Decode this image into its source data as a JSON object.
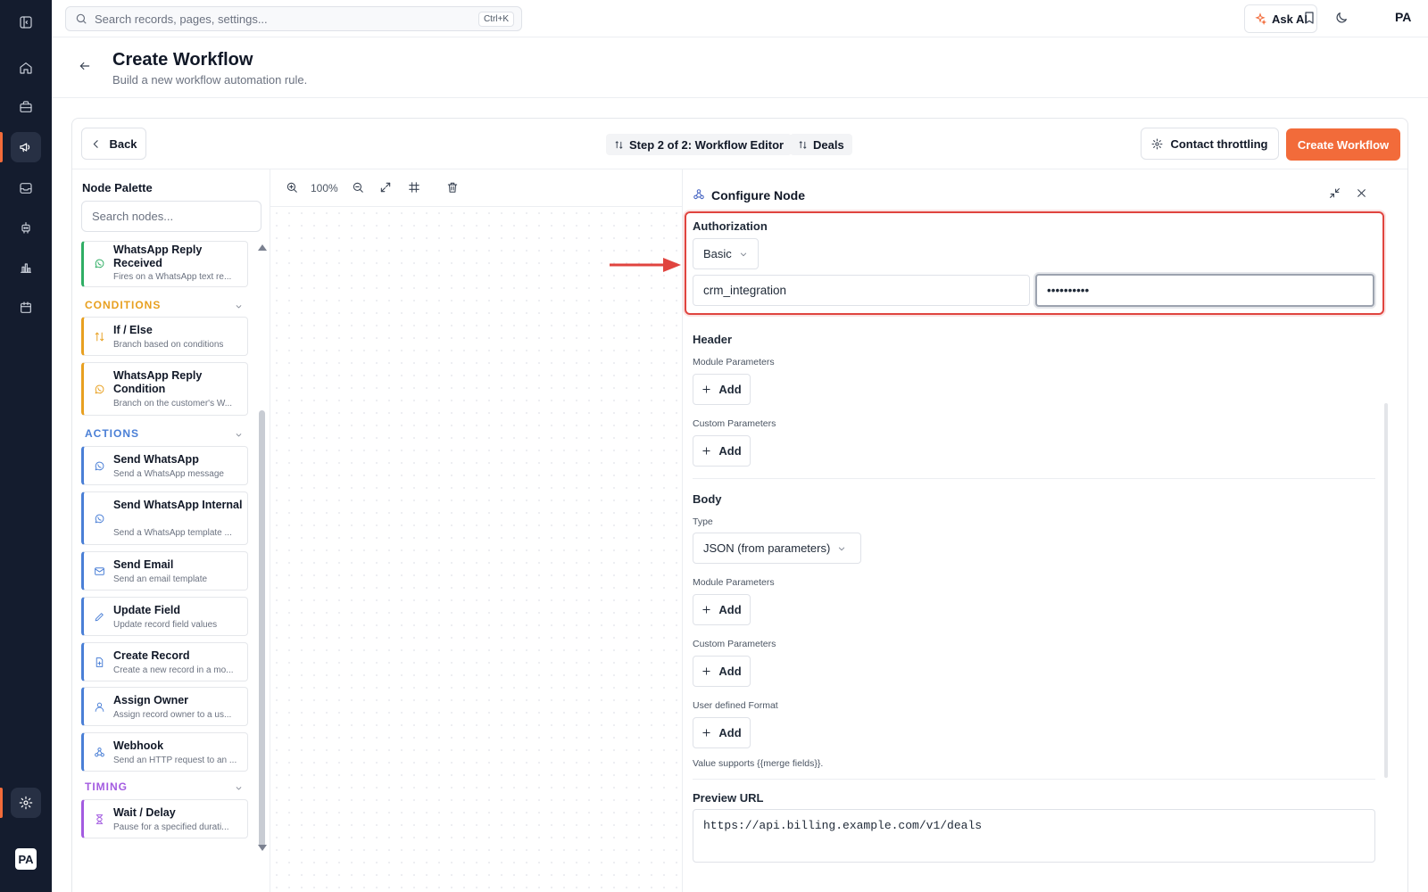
{
  "topbar": {
    "search_placeholder": "Search records, pages, settings...",
    "search_shortcut": "Ctrl+K",
    "ask_ai_label": "Ask AI",
    "avatar": "PA"
  },
  "sidebar": {
    "avatar": "PA",
    "items": [
      "panel-icon",
      "home-icon",
      "briefcase-icon",
      "megaphone-icon",
      "inbox-icon",
      "bot-icon",
      "bar-chart-icon",
      "calendar-icon",
      "gear-icon"
    ]
  },
  "header": {
    "title": "Create Workflow",
    "subtitle": "Build a new workflow automation rule."
  },
  "toolbar": {
    "back_label": "Back",
    "step_label": "Step 2 of 2: Workflow Editor",
    "module_label": "Deals",
    "throttling_label": "Contact throttling",
    "create_label": "Create Workflow"
  },
  "palette": {
    "title": "Node Palette",
    "search_placeholder": "Search nodes...",
    "triggers": [
      {
        "name": "WhatsApp Reply Received",
        "desc": "Fires on a WhatsApp text re..."
      }
    ],
    "categories": {
      "conditions": "CONDITIONS",
      "actions": "ACTIONS",
      "timing": "TIMING"
    },
    "conditions": [
      {
        "name": "If / Else",
        "desc": "Branch based on conditions"
      },
      {
        "name": "WhatsApp Reply Condition",
        "desc": "Branch on the customer's W..."
      }
    ],
    "actions": [
      {
        "name": "Send WhatsApp",
        "desc": "Send a WhatsApp message"
      },
      {
        "name": "Send WhatsApp Internal",
        "desc": "Send a WhatsApp template ..."
      },
      {
        "name": "Send Email",
        "desc": "Send an email template"
      },
      {
        "name": "Update Field",
        "desc": "Update record field values"
      },
      {
        "name": "Create Record",
        "desc": "Create a new record in a mo..."
      },
      {
        "name": "Assign Owner",
        "desc": "Assign record owner to a us..."
      },
      {
        "name": "Webhook",
        "desc": "Send an HTTP request to an ..."
      }
    ],
    "timing": [
      {
        "name": "Wait / Delay",
        "desc": "Pause for a specified durati..."
      }
    ]
  },
  "canvas": {
    "zoom": "100%"
  },
  "config": {
    "title": "Configure Node",
    "authorization": {
      "label": "Authorization",
      "type": "Basic",
      "username": "crm_integration",
      "password": "••••••••••"
    },
    "header": {
      "label": "Header",
      "module_params": "Module Parameters",
      "custom_params": "Custom Parameters",
      "add_label": "Add"
    },
    "body": {
      "label": "Body",
      "type_label": "Type",
      "type_value": "JSON (from parameters)",
      "module_params": "Module Parameters",
      "custom_params": "Custom Parameters",
      "user_format": "User defined Format",
      "add_label": "Add",
      "hint": "Value supports {{merge fields}}."
    },
    "preview": {
      "label": "Preview URL",
      "url": "https://api.billing.example.com/v1/deals"
    }
  },
  "colors": {
    "accent": "#f26b3a",
    "rail": "#141c2e",
    "highlight": "#e0443f",
    "trigger": "#2fae64",
    "conditions": "#e8a020",
    "actions": "#4a7fd6",
    "timing": "#a35be0"
  }
}
